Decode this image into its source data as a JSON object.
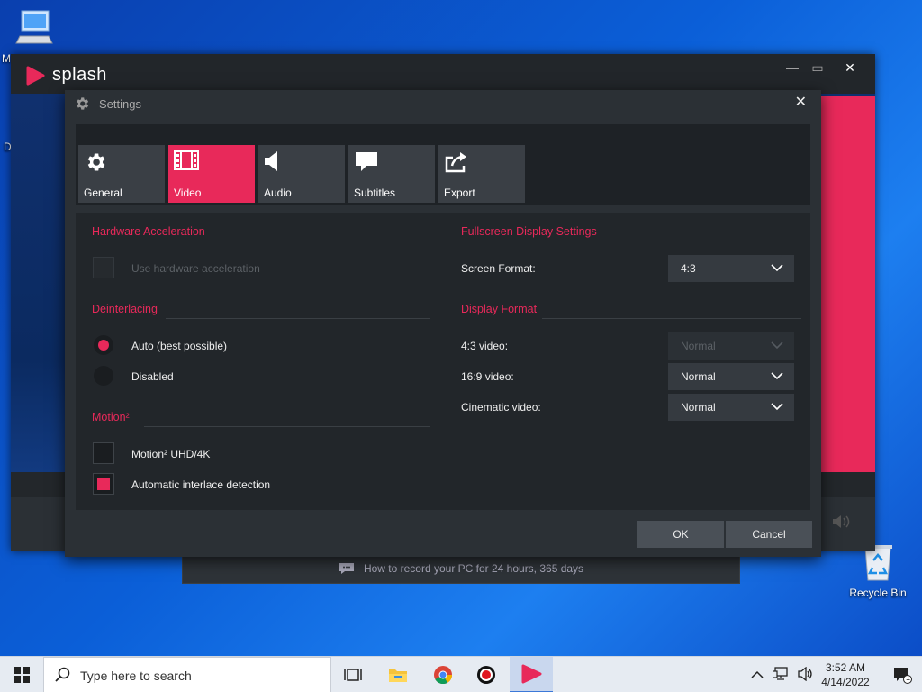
{
  "desktop": {
    "icons": [
      {
        "label": "Recycle Bin",
        "icon": "recycle-bin-icon"
      },
      {
        "label": "",
        "icon": "this-pc-icon"
      }
    ],
    "clipped_labels": [
      "M",
      "D"
    ]
  },
  "splash": {
    "app_name": "splash",
    "window_controls": {
      "minimize": "—",
      "maximize": "▭",
      "close": "✕"
    },
    "tip_text": "How to record your PC for 24 hours, 365 days"
  },
  "settings": {
    "title": "Settings",
    "close_label": "✕",
    "tabs": [
      {
        "label": "General",
        "icon": "gear-icon",
        "active": false
      },
      {
        "label": "Video",
        "icon": "film-icon",
        "active": true
      },
      {
        "label": "Audio",
        "icon": "speaker-icon",
        "active": false
      },
      {
        "label": "Subtitles",
        "icon": "speech-bubble-icon",
        "active": false
      },
      {
        "label": "Export",
        "icon": "share-icon",
        "active": false
      }
    ],
    "hardware": {
      "title": "Hardware Acceleration",
      "use_hw_label": "Use hardware acceleration",
      "use_hw_checked": false,
      "use_hw_enabled": false
    },
    "deinterlacing": {
      "title": "Deinterlacing",
      "options": [
        {
          "label": "Auto (best possible)",
          "selected": true
        },
        {
          "label": "Disabled",
          "selected": false
        }
      ]
    },
    "motion": {
      "title": "Motion²",
      "uhd_label": "Motion²  UHD/4K",
      "uhd_checked": false,
      "auto_interlace_label": "Automatic interlace detection",
      "auto_interlace_checked": true
    },
    "fullscreen": {
      "title": "Fullscreen Display Settings",
      "screen_format_label": "Screen Format:",
      "screen_format_value": "4:3"
    },
    "display_format": {
      "title": "Display Format",
      "rows": [
        {
          "label": "4:3 video:",
          "value": "Normal",
          "enabled": false
        },
        {
          "label": "16:9 video:",
          "value": "Normal",
          "enabled": true
        },
        {
          "label": "Cinematic video:",
          "value": "Normal",
          "enabled": true
        }
      ]
    },
    "buttons": {
      "ok": "OK",
      "cancel": "Cancel"
    }
  },
  "taskbar": {
    "search_placeholder": "Type here to search",
    "apps": [
      {
        "name": "task-view",
        "active": false
      },
      {
        "name": "file-explorer",
        "active": false
      },
      {
        "name": "chrome",
        "active": false
      },
      {
        "name": "recorder",
        "active": false
      },
      {
        "name": "splash",
        "active": true
      }
    ],
    "time": "3:52 AM",
    "date": "4/14/2022",
    "notification_count": "1"
  },
  "colors": {
    "accent": "#e8295a",
    "dialog_bg": "#2b3035",
    "desktop_blue": "#0b5fd8"
  }
}
